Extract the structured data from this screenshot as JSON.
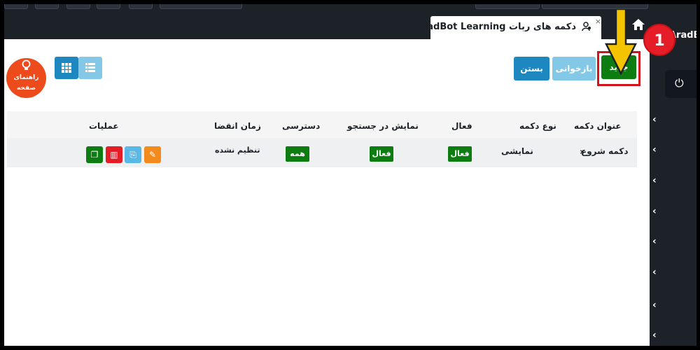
{
  "header": {
    "tab_title": "دکمه های ربات AradBot Learning",
    "brand": "AradB"
  },
  "toolbar": {
    "new_label": "جدید",
    "reload_label": "بازخوانی",
    "close_label": "بستن"
  },
  "guide": {
    "label": "راهنمای صفحه"
  },
  "annotation": {
    "badge_number": "1"
  },
  "table": {
    "headers": [
      "عنوان دکمه",
      "نوع دکمه",
      "فعال",
      "نمایش در جستجو",
      "دسترسی",
      "زمان انقضا",
      "عملیات"
    ],
    "rows": [
      {
        "title": "دکمه شروع",
        "type": "نمایشی",
        "active": "فعال",
        "search": "فعال",
        "access": "همه",
        "expiry": "تنظیم نشده"
      }
    ]
  },
  "colors": {
    "dark": "#1d2229",
    "green": "#0d7c11",
    "blue": "#1d87c0",
    "light_blue": "#84c8e8",
    "red": "#e41d26",
    "orange": "#ee4b1c",
    "yellow": "#f5c400"
  },
  "icons": [
    "user-icon",
    "close-icon",
    "home-icon",
    "power-icon",
    "chevron-left-icon",
    "grid-icon",
    "list-icon",
    "lightbulb-icon",
    "edit-icon",
    "copy-icon",
    "delete-icon",
    "duplicate-icon"
  ]
}
